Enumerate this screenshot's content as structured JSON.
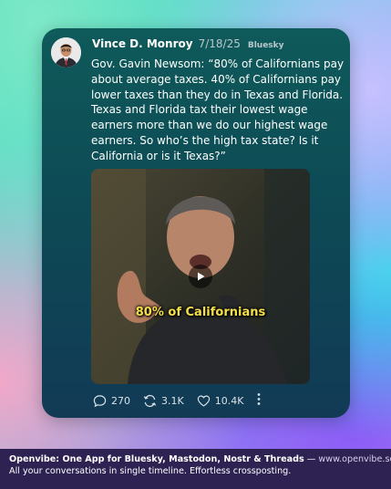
{
  "post": {
    "author": "Vince D. Monroy",
    "date": "7/18/25",
    "network": "Bluesky",
    "text": "Gov. Gavin Newsom: “80% of Californians pay about average taxes. 40% of Californians pay lower taxes than they do in Texas and Florida. Texas and Florida tax their lowest wage earners more than we do our highest wage earners. So who’s the high tax state? Is it California or is it Texas?”",
    "video_caption": "80% of Californians",
    "replies": "270",
    "reposts": "3.1K",
    "likes": "10.4K",
    "icons": [
      "reply-icon",
      "repost-icon",
      "heart-icon",
      "more-icon",
      "play-icon"
    ]
  },
  "footer": {
    "headline": "Openvibe: One App for Bluesky, Mastodon, Nostr & Threads",
    "separator": "—",
    "url": "www.openvibe.social",
    "tagline": "All your conversations in single timeline. Effortless crossposting."
  },
  "colors": {
    "card": "#0f5a5a",
    "caption": "#f5e04a",
    "footer_bg": "#2d2252"
  }
}
